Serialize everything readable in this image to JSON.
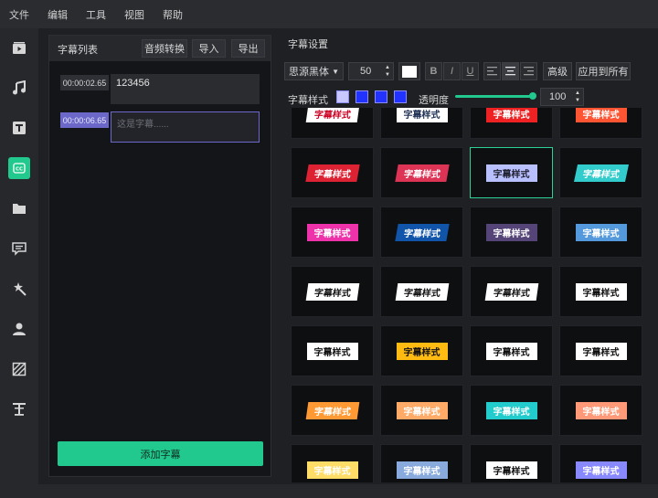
{
  "menu": [
    "文件",
    "编辑",
    "工具",
    "视图",
    "帮助"
  ],
  "sidebar_icons": [
    "media-icon",
    "music-icon",
    "text-icon",
    "subtitle-cc-icon",
    "folder-icon",
    "chat-icon",
    "magic-wand-icon",
    "person-icon",
    "pattern-icon",
    "text-format-icon"
  ],
  "left_panel": {
    "title": "字幕列表",
    "convert_label": "音频转换",
    "import_label": "导入",
    "export_label": "导出",
    "entries": [
      {
        "time": "00:00:02.65",
        "text": "123456"
      },
      {
        "time": "00:00:06.65",
        "placeholder": "这是字幕......"
      }
    ],
    "add_label": "添加字幕"
  },
  "settings": {
    "title": "字幕设置",
    "font": "思源黑体",
    "font_size": "50",
    "bold": "B",
    "italic": "I",
    "underline": "U",
    "advanced_label": "高级",
    "apply_all_label": "应用到所有",
    "style_label": "字幕样式",
    "opacity_label": "透明度",
    "opacity_value": "100",
    "opacity_fraction": 1.0
  },
  "styles": {
    "sample_text": "字幕样式",
    "selected_index": 6
  },
  "colors": {
    "accent": "#22c98e",
    "panel_bg": "#141518",
    "app_bg": "#1e2023"
  }
}
